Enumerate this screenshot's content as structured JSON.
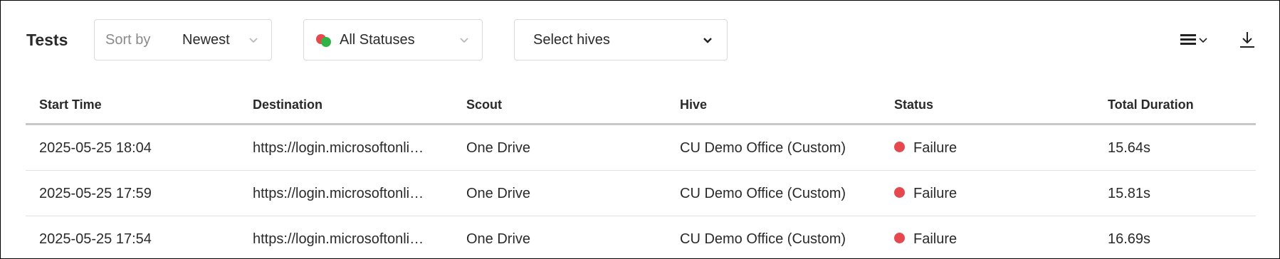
{
  "header": {
    "title": "Tests"
  },
  "sort": {
    "prefix": "Sort by",
    "value": "Newest"
  },
  "status_filter": {
    "value": "All Statuses",
    "dot_colors": [
      "#e5484d",
      "#2fb344"
    ]
  },
  "hives_filter": {
    "placeholder": "Select hives"
  },
  "toolbar_icons": {
    "menu": "list-menu-icon",
    "download": "download-icon"
  },
  "table": {
    "columns": [
      "Start Time",
      "Destination",
      "Scout",
      "Hive",
      "Status",
      "Total Duration"
    ],
    "rows": [
      {
        "start_time": "2025-05-25 18:04",
        "destination": "https://login.microsoftonli…",
        "scout": "One Drive",
        "hive": "CU Demo Office (Custom)",
        "status": "Failure",
        "status_color": "#e5484d",
        "duration": "15.64s"
      },
      {
        "start_time": "2025-05-25 17:59",
        "destination": "https://login.microsoftonli…",
        "scout": "One Drive",
        "hive": "CU Demo Office (Custom)",
        "status": "Failure",
        "status_color": "#e5484d",
        "duration": "15.81s"
      },
      {
        "start_time": "2025-05-25 17:54",
        "destination": "https://login.microsoftonli…",
        "scout": "One Drive",
        "hive": "CU Demo Office (Custom)",
        "status": "Failure",
        "status_color": "#e5484d",
        "duration": "16.69s"
      }
    ]
  }
}
